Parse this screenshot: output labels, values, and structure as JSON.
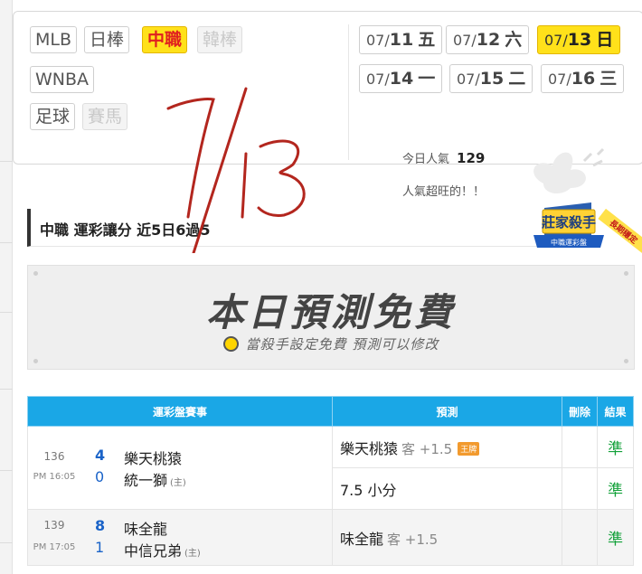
{
  "leagues": [
    {
      "label": "MLB",
      "state": "normal"
    },
    {
      "label": "日棒",
      "state": "normal"
    },
    {
      "label": "中職",
      "state": "active"
    },
    {
      "label": "韓棒",
      "state": "disabled"
    },
    {
      "label": "WNBA",
      "state": "normal"
    },
    {
      "label": "足球",
      "state": "normal"
    },
    {
      "label": "賽馬",
      "state": "disabled"
    }
  ],
  "dates": [
    {
      "md": "07/",
      "day": "11",
      "wd": "五",
      "active": false
    },
    {
      "md": "07/",
      "day": "12",
      "wd": "六",
      "active": false
    },
    {
      "md": "07/",
      "day": "13",
      "wd": "日",
      "active": true
    },
    {
      "md": "07/",
      "day": "14",
      "wd": "一",
      "active": false
    },
    {
      "md": "07/",
      "day": "15",
      "wd": "二",
      "active": false
    },
    {
      "md": "07/",
      "day": "16",
      "wd": "三",
      "active": false
    }
  ],
  "popularity": {
    "label": "今日人氣",
    "value": "129",
    "note": "人氣超旺的！！"
  },
  "heading": "中職 運彩讓分 近5日6過5",
  "badge": {
    "title": "莊家殺手",
    "sub": "中職運彩盤",
    "ribbon": "長期穩定"
  },
  "banner": {
    "title": "本日預測免費",
    "subtitle": "當殺手設定免費 預測可以修改"
  },
  "handwriting": "7/13",
  "table": {
    "headers": [
      "運彩盤賽事",
      "預測",
      "刪除",
      "結果"
    ],
    "games": [
      {
        "no": "136",
        "time": "PM 16:05",
        "away": {
          "score": "4",
          "name": "樂天桃猿",
          "mark": ""
        },
        "home": {
          "score": "0",
          "name": "統一獅",
          "mark": "(主)"
        },
        "picks": [
          {
            "text": "樂天桃猿",
            "side": "客 +1.5",
            "tag": "王牌",
            "result": "準"
          },
          {
            "text": "7.5 小分",
            "side": "",
            "tag": "",
            "result": "準"
          }
        ]
      },
      {
        "no": "139",
        "time": "PM 17:05",
        "away": {
          "score": "8",
          "name": "味全龍",
          "mark": ""
        },
        "home": {
          "score": "1",
          "name": "中信兄弟",
          "mark": "(主)"
        },
        "picks": [
          {
            "text": "味全龍",
            "side": "客 +1.5",
            "tag": "",
            "result": "準"
          }
        ]
      }
    ]
  }
}
